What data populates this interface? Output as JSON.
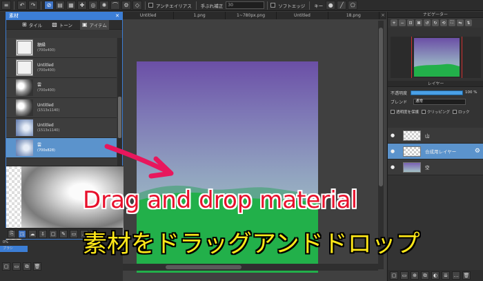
{
  "toolbar": {
    "antialias_label": "アンチエイリアス",
    "stabilizer_label": "手ぶれ補正",
    "stabilizer_value": "30",
    "softedge_label": "ソフトエッジ",
    "key_label": "キー"
  },
  "document_tabs": [
    "Untitled",
    "1.png",
    "1~780px.png",
    "Untitled",
    "18.png"
  ],
  "material_panel": {
    "title": "素材",
    "tabs": [
      {
        "label": "タイル",
        "icon": "tile-icon"
      },
      {
        "label": "トーン",
        "icon": "tone-icon"
      },
      {
        "label": "アイテム",
        "icon": "item-icon"
      }
    ],
    "items": [
      {
        "name": "額縁",
        "size": "(700x400)",
        "thumb": "frame"
      },
      {
        "name": "Untitled",
        "size": "(700x400)",
        "thumb": "frame"
      },
      {
        "name": "雲",
        "size": "(700x400)",
        "thumb": "cloud"
      },
      {
        "name": "Untitled",
        "size": "(1513x1140)",
        "thumb": "cloud"
      },
      {
        "name": "Untitled",
        "size": "(1513x1140)",
        "thumb": "sky"
      },
      {
        "name": "雲",
        "size": "(700x828)",
        "thumb": "sky",
        "selected": true
      }
    ]
  },
  "left_lower": {
    "row1": "0%",
    "row2": "ブラシ"
  },
  "navigator": {
    "title": "ナビゲーター"
  },
  "layer_panel": {
    "title": "レイヤー",
    "opacity_label": "不透明度",
    "opacity_value": "100 %",
    "blend_label": "ブレンド",
    "blend_value": "通常",
    "protect_alpha": "透明度を保護",
    "clipping": "クリッピング",
    "lock": "ロック",
    "layers": [
      {
        "name": "山",
        "thumb": "checker",
        "selected": false
      },
      {
        "name": "合成用レイヤー",
        "thumb": "checker",
        "selected": true
      },
      {
        "name": "空",
        "thumb": "sky",
        "selected": false
      }
    ]
  },
  "caption": {
    "english": "Drag and drop material",
    "japanese": "素材をドラッグアンドドロップ"
  },
  "colors": {
    "accent_blue": "#3c7ed6",
    "selected_row": "#5b93cc",
    "arrow_pink": "#e8175d",
    "caption_red": "#e8102c",
    "caption_yellow": "#ffe818",
    "hill_green": "#22b04a"
  }
}
